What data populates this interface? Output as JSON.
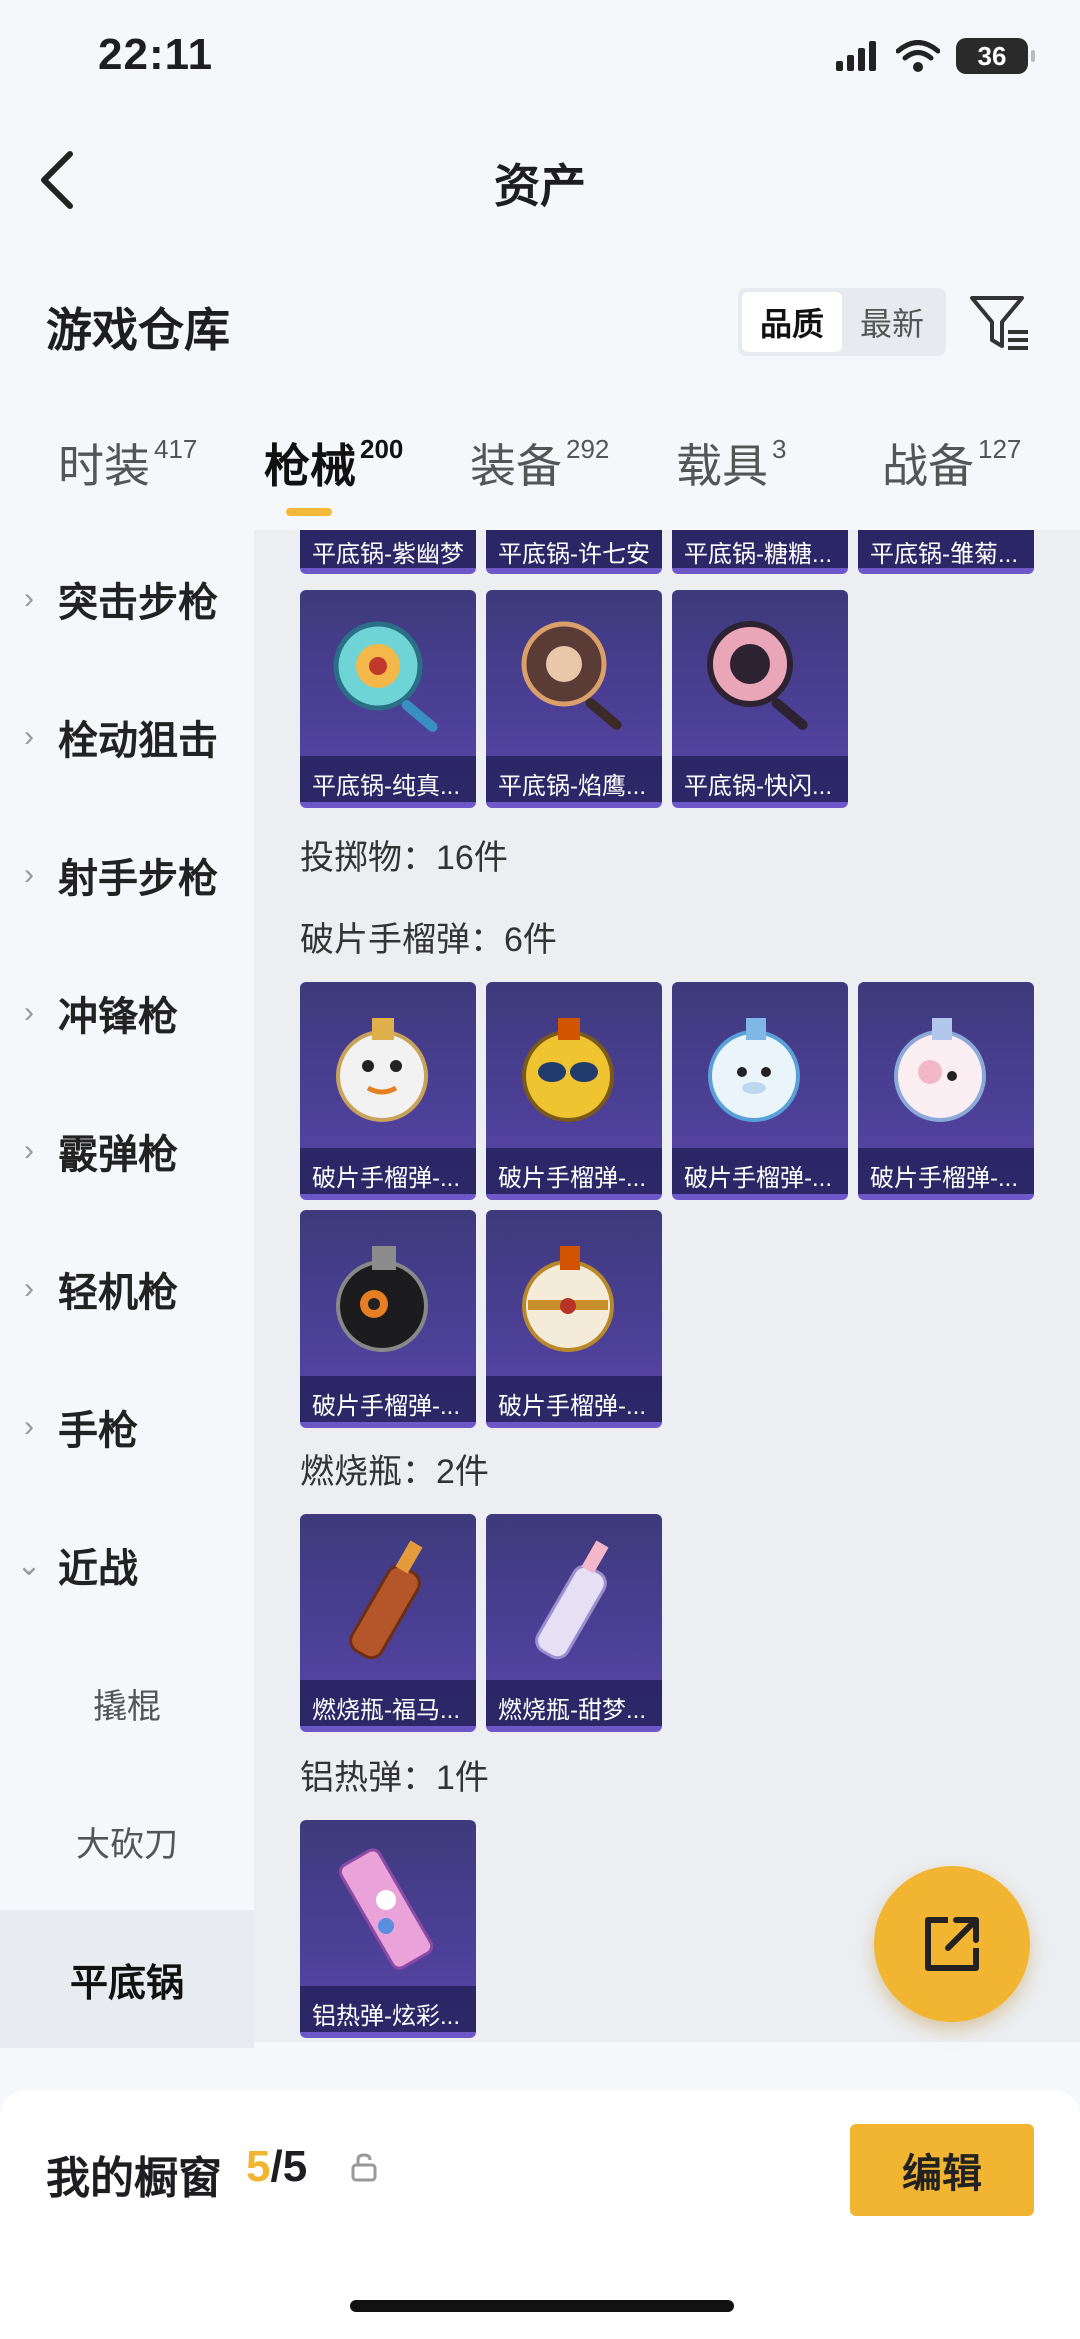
{
  "status": {
    "time": "22:11",
    "battery": "36"
  },
  "header": {
    "title": "资产"
  },
  "warehouse": {
    "title": "游戏仓库",
    "sort_options": [
      "品质",
      "最新"
    ],
    "active_sort": "品质"
  },
  "tabs": [
    {
      "label": "时装",
      "count": "417"
    },
    {
      "label": "枪械",
      "count": "200",
      "active": true
    },
    {
      "label": "装备",
      "count": "292"
    },
    {
      "label": "载具",
      "count": "3"
    },
    {
      "label": "战备",
      "count": "127"
    }
  ],
  "sidebar": {
    "items": [
      "突击步枪",
      "栓动狙击",
      "射手步枪",
      "冲锋枪",
      "霰弹枪",
      "轻机枪",
      "手枪",
      "近战"
    ],
    "sub_items": [
      "撬棍",
      "大砍刀",
      "平底锅"
    ],
    "active_sub": "平底锅"
  },
  "content": {
    "pan_top_row": [
      "平底锅-紫幽梦",
      "平底锅-许七安",
      "平底锅-糖糖...",
      "平底锅-雏菊..."
    ],
    "pan_row": [
      "平底锅-纯真...",
      "平底锅-焰鹰...",
      "平底锅-快闪..."
    ],
    "throwables_label": "投掷物：16件",
    "frag_label": "破片手榴弹：6件",
    "frag_items": [
      "破片手榴弹-...",
      "破片手榴弹-...",
      "破片手榴弹-...",
      "破片手榴弹-...",
      "破片手榴弹-...",
      "破片手榴弹-..."
    ],
    "molotov_label": "燃烧瓶：2件",
    "molotov_items": [
      "燃烧瓶-福马...",
      "燃烧瓶-甜梦..."
    ],
    "thermite_label": "铝热弹：1件",
    "thermite_items": [
      "铝热弹-炫彩..."
    ]
  },
  "showcase": {
    "title": "我的橱窗",
    "current": "5",
    "total": "/5",
    "edit_label": "编辑"
  },
  "colors": {
    "accent": "#f2b531",
    "card": "#4b3f95"
  }
}
